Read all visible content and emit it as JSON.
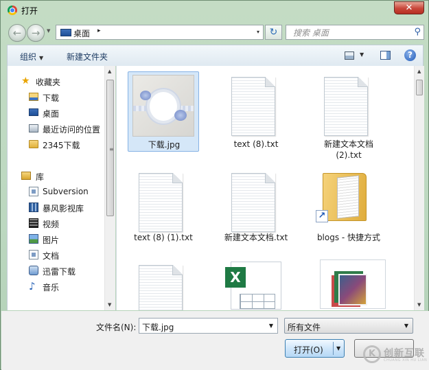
{
  "window": {
    "title": "打开",
    "close_glyph": "✕"
  },
  "address": {
    "location": "桌面",
    "arrow": "▸",
    "dropdown": "▾"
  },
  "search": {
    "placeholder": "搜索 桌面"
  },
  "toolbar": {
    "organize": "组织",
    "new_folder": "新建文件夹"
  },
  "nav": {
    "items": [
      {
        "label": "收藏夹",
        "icon": "star-icon"
      },
      {
        "label": "下载",
        "icon": "download-folder-icon"
      },
      {
        "label": "桌面",
        "icon": "desktop-icon"
      },
      {
        "label": "最近访问的位置",
        "icon": "recent-places-icon"
      },
      {
        "label": "2345下载",
        "icon": "folder-icon"
      },
      {
        "label": "库",
        "icon": "library-icon"
      },
      {
        "label": "Subversion",
        "icon": "document-icon"
      },
      {
        "label": "暴风影视库",
        "icon": "media-library-icon"
      },
      {
        "label": "视频",
        "icon": "video-icon"
      },
      {
        "label": "图片",
        "icon": "pictures-icon"
      },
      {
        "label": "文档",
        "icon": "documents-icon"
      },
      {
        "label": "迅雷下载",
        "icon": "thunder-icon"
      },
      {
        "label": "音乐",
        "icon": "music-icon"
      }
    ]
  },
  "files": [
    {
      "name": "下载.jpg",
      "type": "image",
      "selected": true
    },
    {
      "name": "text (8).txt",
      "type": "text"
    },
    {
      "name": "新建文本文档 (2).txt",
      "type": "text"
    },
    {
      "name": "text (8) (1).txt",
      "type": "text"
    },
    {
      "name": "新建文本文档.txt",
      "type": "text"
    },
    {
      "name": "blogs - 快捷方式",
      "type": "shortcut"
    },
    {
      "name": "",
      "type": "text"
    },
    {
      "name": "",
      "type": "excel"
    },
    {
      "name": "",
      "type": "image"
    }
  ],
  "bottom": {
    "filename_label": "文件名(N):",
    "filename_value": "下载.jpg",
    "filter_value": "所有文件",
    "open_label": "打开(O)"
  },
  "watermark": {
    "text": "创新互联",
    "sub": "CHUANG XIN HU LIAN"
  }
}
